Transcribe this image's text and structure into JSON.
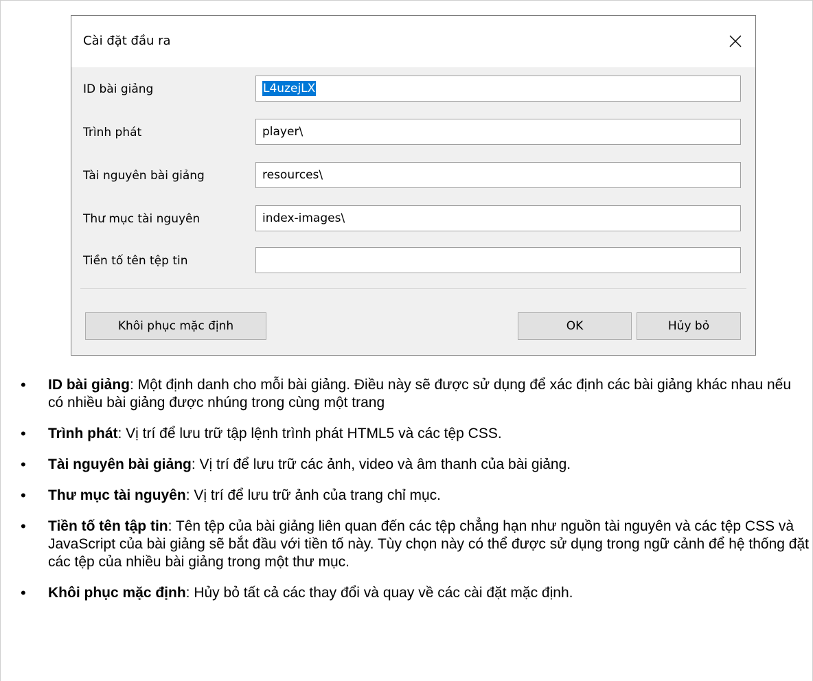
{
  "dialog": {
    "title": "Cài đặt đầu ra",
    "fields": [
      {
        "label": "ID bài giảng",
        "value": "L4uzejLX"
      },
      {
        "label": "Trình phát",
        "value": "player\\"
      },
      {
        "label": "Tài nguyên bài giảng",
        "value": "resources\\"
      },
      {
        "label": "Thư mục tài nguyên",
        "value": "index-images\\"
      },
      {
        "label": "Tiền tố tên tệp tin",
        "value": ""
      }
    ],
    "buttons": {
      "restore": "Khôi phục mặc định",
      "ok": "OK",
      "cancel": "Hủy bỏ"
    }
  },
  "descriptions": [
    {
      "term": "ID bài giảng",
      "text": ": Một định danh cho mỗi bài giảng. Điều này sẽ được sử dụng để xác định các bài giảng khác nhau nếu có nhiều bài giảng được nhúng trong cùng một trang"
    },
    {
      "term": "Trình phát",
      "text": ": Vị trí để lưu trữ tập lệnh trình phát HTML5 và các tệp CSS."
    },
    {
      "term": "Tài nguyên bài giảng",
      "text": ": Vị trí để lưu trữ các ảnh, video và âm thanh của bài giảng."
    },
    {
      "term": "Thư mục tài nguyên",
      "text": ": Vị trí để lưu trữ ảnh của trang chỉ mục."
    },
    {
      "term": "Tiền tố tên tập tin",
      "text": ": Tên tệp của bài giảng liên quan đến các tệp chẳng hạn như nguồn tài nguyên và các tệp CSS và JavaScript của bài giảng sẽ bắt đầu với tiền tố này. Tùy chọn này có thể được sử dụng trong ngữ cảnh để hệ thống đặt các tệp của nhiều bài giảng trong một thư mục."
    },
    {
      "term": "Khôi phục mặc định",
      "text": ": Hủy bỏ tất cả các thay đổi và quay về các cài đặt mặc định."
    }
  ],
  "icons": {
    "close": "close-icon",
    "bullet": "•"
  }
}
